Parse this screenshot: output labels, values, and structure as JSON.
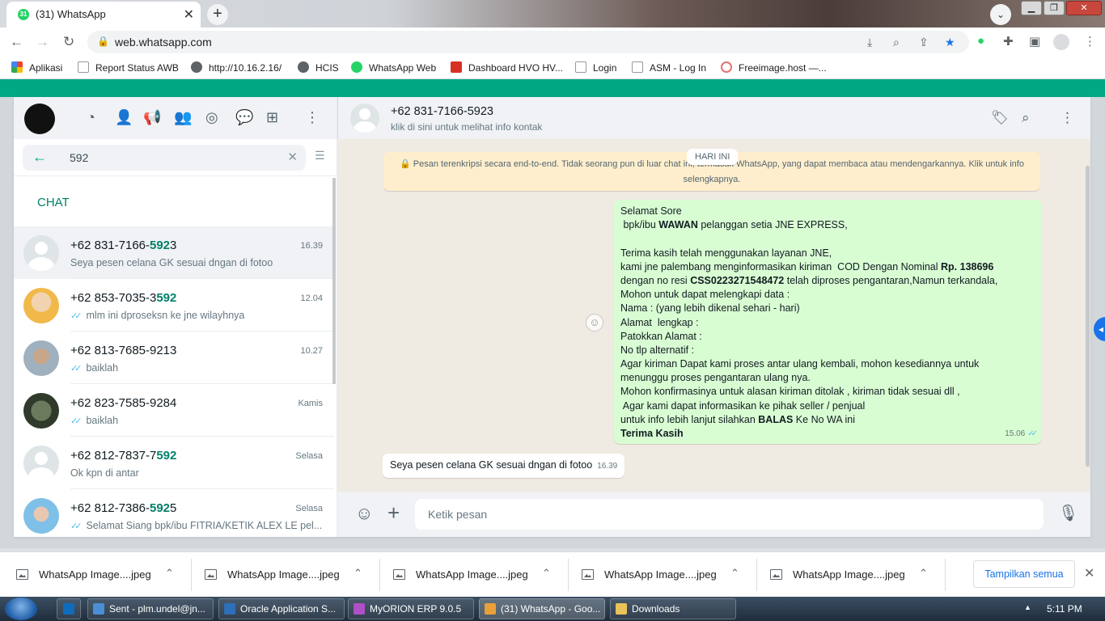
{
  "browser": {
    "tab_title": "(31) WhatsApp",
    "tab_badge": "31",
    "url": "web.whatsapp.com",
    "bookmarks": [
      "Aplikasi",
      "Report Status AWB",
      "http://10.16.2.16/",
      "HCIS",
      "WhatsApp Web",
      "Dashboard HVO HV...",
      "Login",
      "ASM - Log In",
      "Freeimage.host —..."
    ]
  },
  "left": {
    "search_value": "592",
    "section_label": "CHAT",
    "chats": [
      {
        "name_pre": "+62 831-7166-",
        "name_match": "592",
        "name_post": "3",
        "time": "16.39",
        "message": "Seya pesen celana GK sesuai dngan di fotoo",
        "read": false,
        "avatar": "default"
      },
      {
        "name_pre": "+62 853-7035-3",
        "name_match": "592",
        "name_post": "",
        "time": "12.04",
        "message": "mlm ini  dproseksn ke jne wilayhnya",
        "read": true,
        "avatar": "photo1"
      },
      {
        "name_pre": "+62 813-7685-9213",
        "name_match": "",
        "name_post": "",
        "time": "10.27",
        "message": "baiklah",
        "read": true,
        "avatar": "photo2"
      },
      {
        "name_pre": "+62 823-7585-9284",
        "name_match": "",
        "name_post": "",
        "time": "Kamis",
        "message": "baiklah",
        "read": true,
        "avatar": "photo3"
      },
      {
        "name_pre": "+62 812-7837-7",
        "name_match": "592",
        "name_post": "",
        "time": "Selasa",
        "message": "Ok kpn di antar",
        "read": false,
        "avatar": "default"
      },
      {
        "name_pre": "+62 812-7386-",
        "name_match": "592",
        "name_post": "5",
        "time": "Selasa",
        "message": "Selamat Siang   bpk/ibu FITRIA/KETIK ALEX LE pel...",
        "read": true,
        "avatar": "photo4"
      }
    ]
  },
  "conversation": {
    "contact_name": "+62 831-7166-5923",
    "contact_sub": "klik di sini untuk melihat info kontak",
    "date_chip": "HARI INI",
    "encryption_notice": "Pesan terenkripsi secara end-to-end. Tidak seorang pun di luar chat ini, termasuk WhatsApp, yang dapat membaca atau mendengarkannya. Klik untuk info selengkapnya.",
    "outgoing": {
      "lines": [
        [
          {
            "t": "Selamat Sore"
          }
        ],
        [
          {
            "t": " bpk/ibu "
          },
          {
            "t": "WAWAN",
            "b": true
          },
          {
            "t": " pelanggan setia JNE EXPRESS,"
          }
        ],
        [
          {
            "t": ""
          }
        ],
        [
          {
            "t": "Terima kasih telah menggunakan layanan JNE,"
          }
        ],
        [
          {
            "t": "kami jne palembang menginformasikan kiriman  COD Dengan Nominal "
          },
          {
            "t": "Rp. 138696",
            "b": true
          }
        ],
        [
          {
            "t": "dengan no resi "
          },
          {
            "t": "CSS0223271548472",
            "b": true
          },
          {
            "t": " telah diproses pengantaran,Namun terkandala,"
          }
        ],
        [
          {
            "t": "Mohon untuk dapat melengkapi data :"
          }
        ],
        [
          {
            "t": "Nama : (yang lebih dikenal sehari - hari)"
          }
        ],
        [
          {
            "t": "Alamat  lengkap :"
          }
        ],
        [
          {
            "t": "Patokkan Alamat :"
          }
        ],
        [
          {
            "t": "No tlp alternatif :"
          }
        ],
        [
          {
            "t": "Agar kiriman Dapat kami proses antar ulang kembali, mohon kesediannya untuk"
          }
        ],
        [
          {
            "t": "menunggu proses pengantaran ulang nya."
          }
        ],
        [
          {
            "t": "Mohon konfirmasinya untuk alasan kiriman ditolak , kiriman tidak sesuai dll ,"
          }
        ],
        [
          {
            "t": " Agar kami dapat informasikan ke pihak seller / penjual"
          }
        ],
        [
          {
            "t": "untuk info lebih lanjut silahkan "
          },
          {
            "t": "BALAS",
            "b": true
          },
          {
            "t": " Ke No WA ini"
          }
        ],
        [
          {
            "t": "Terima Kasih",
            "b": true
          }
        ]
      ],
      "time": "15.06"
    },
    "incoming": {
      "text": "Seya pesen celana GK sesuai dngan di fotoo",
      "time": "16.39"
    },
    "composer_placeholder": "Ketik pesan"
  },
  "downloads": {
    "files": [
      "WhatsApp Image....jpeg",
      "WhatsApp Image....jpeg",
      "WhatsApp Image....jpeg",
      "WhatsApp Image....jpeg",
      "WhatsApp Image....jpeg"
    ],
    "show_all": "Tampilkan semua"
  },
  "taskbar": {
    "items": [
      "Sent - plm.undel@jn...",
      "Oracle Application S...",
      "MyORION ERP 9.0.5",
      "(31) WhatsApp - Goo...",
      "Downloads"
    ],
    "clock": "5:11 PM"
  },
  "colors": {
    "wa_green": "#00a884",
    "wa_highlight": "#008069",
    "outgoing_bubble": "#d9fdd3",
    "tick_blue": "#53bdeb"
  }
}
